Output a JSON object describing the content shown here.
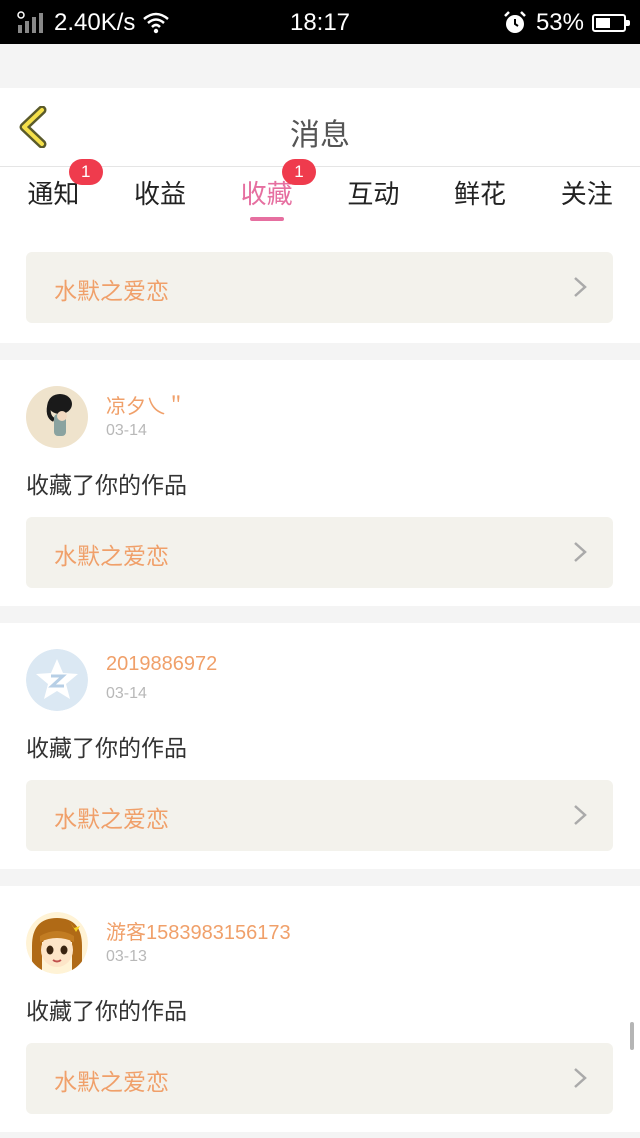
{
  "statusbar": {
    "network": "2.40K/s",
    "time": "18:17",
    "battery": "53%"
  },
  "header": {
    "title": "消息"
  },
  "tabs": [
    {
      "label": "通知",
      "badge": "1",
      "active": false
    },
    {
      "label": "收益",
      "badge": "",
      "active": false
    },
    {
      "label": "收藏",
      "badge": "1",
      "active": true
    },
    {
      "label": "互动",
      "badge": "",
      "active": false
    },
    {
      "label": "鲜花",
      "badge": "",
      "active": false
    },
    {
      "label": "关注",
      "badge": "",
      "active": false
    }
  ],
  "first_card": {
    "work_title": "水默之爱恋"
  },
  "items": [
    {
      "username": "凉夕乀＂",
      "date": "03-14",
      "action": "收藏了你的作品",
      "work_title": "水默之爱恋",
      "avatar": "girl-photo-avatar"
    },
    {
      "username": "2019886972",
      "date": "03-14",
      "action": "收藏了你的作品",
      "work_title": "水默之爱恋",
      "avatar": "qq-default-avatar"
    },
    {
      "username": "游客1583983156173",
      "date": "03-13",
      "action": "收藏了你的作品",
      "work_title": "水默之爱恋",
      "avatar": "cartoon-girl-avatar"
    }
  ],
  "colors": {
    "accent": "#e66fa0",
    "username": "#f0a06a",
    "badge": "#ef3b4d",
    "work_bg": "#f3f2ec"
  }
}
